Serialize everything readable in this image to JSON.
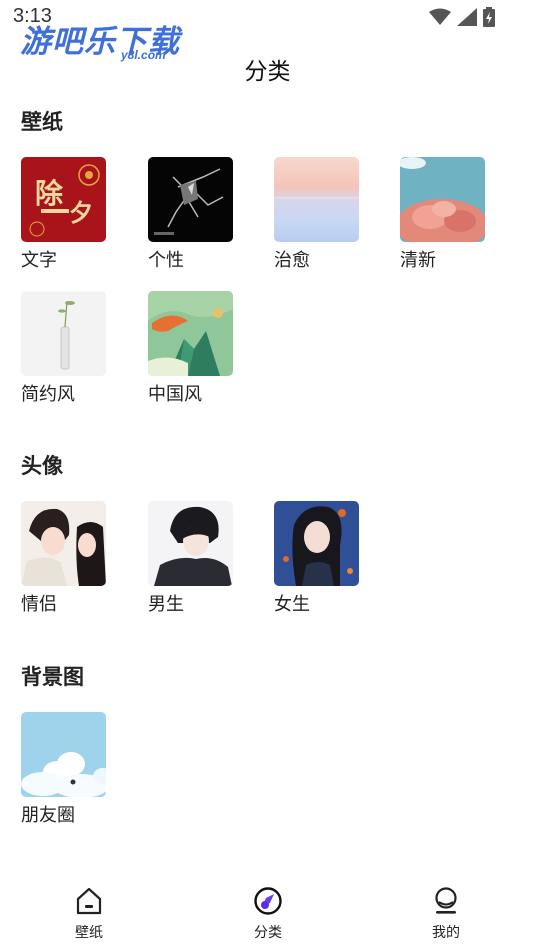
{
  "status_bar": {
    "time": "3:13",
    "watermark_main": "游吧乐下载",
    "watermark_sub": "y8l.com",
    "icons": [
      "wifi-icon",
      "signal-icon",
      "battery-icon"
    ]
  },
  "header": {
    "title": "分类"
  },
  "sections": {
    "wallpaper": {
      "title": "壁纸",
      "items": [
        {
          "label": "文字",
          "thumb": "red-new-year-text"
        },
        {
          "label": "个性",
          "thumb": "black-shattered"
        },
        {
          "label": "治愈",
          "thumb": "pastel-sea-sky"
        },
        {
          "label": "清新",
          "thumb": "pink-tree-teal-sky"
        },
        {
          "label": "简约风",
          "thumb": "white-vase"
        },
        {
          "label": "中国风",
          "thumb": "chinese-landscape"
        }
      ]
    },
    "avatar": {
      "title": "头像",
      "items": [
        {
          "label": "情侣",
          "thumb": "anime-couple"
        },
        {
          "label": "男生",
          "thumb": "anime-boy"
        },
        {
          "label": "女生",
          "thumb": "anime-girl-blue"
        }
      ]
    },
    "background": {
      "title": "背景图",
      "items": [
        {
          "label": "朋友圈",
          "thumb": "clouds-sky"
        }
      ]
    }
  },
  "bottom_nav": {
    "items": [
      {
        "label": "壁纸",
        "icon": "home-icon"
      },
      {
        "label": "分类",
        "icon": "compass-icon",
        "active": true
      },
      {
        "label": "我的",
        "icon": "profile-icon"
      }
    ],
    "accent": "#6a3cf0"
  }
}
